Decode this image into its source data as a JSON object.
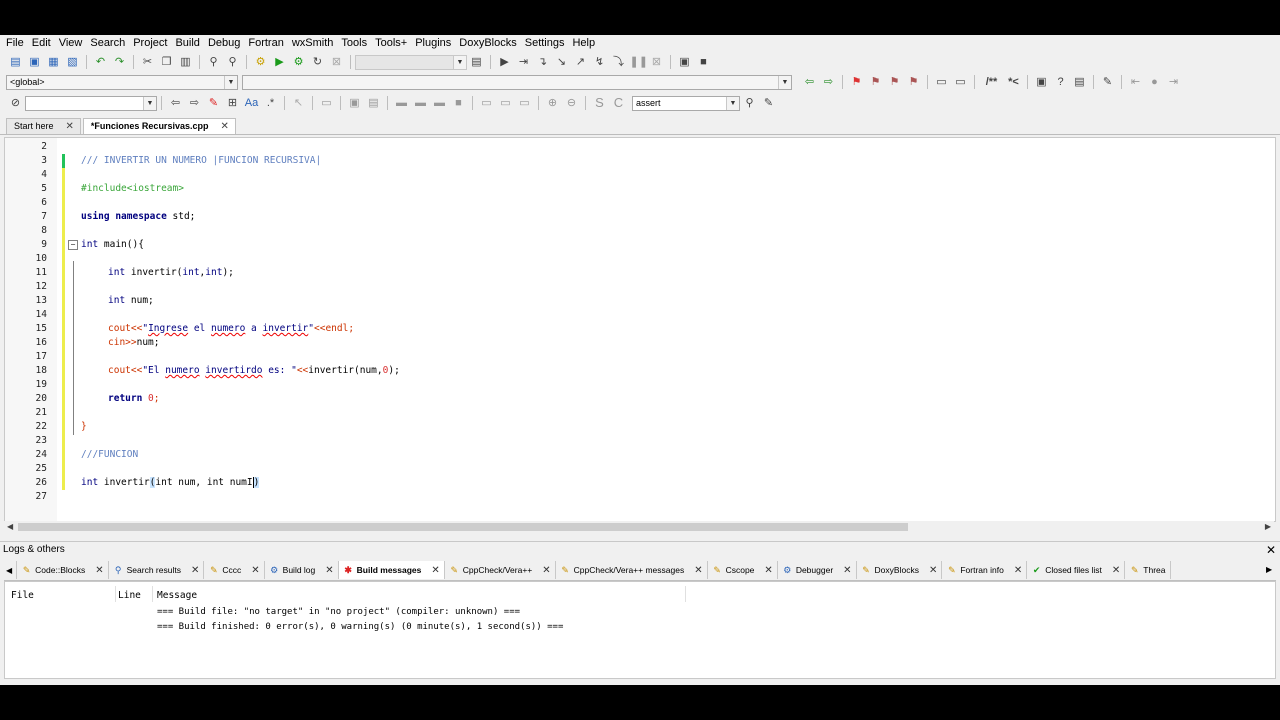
{
  "menu": [
    "File",
    "Edit",
    "View",
    "Search",
    "Project",
    "Build",
    "Debug",
    "Fortran",
    "wxSmith",
    "Tools",
    "Tools+",
    "Plugins",
    "DoxyBlocks",
    "Settings",
    "Help"
  ],
  "toolbar": {
    "scope_combo": "<global>",
    "search_combo_value": "assert"
  },
  "tabs": [
    {
      "label": "Start here",
      "active": false
    },
    {
      "label": "*Funciones Recursivas.cpp",
      "active": true
    }
  ],
  "editor": {
    "line_numbers": [
      "2",
      "3",
      "4",
      "5",
      "6",
      "7",
      "8",
      "9",
      "10",
      "11",
      "12",
      "13",
      "14",
      "15",
      "16",
      "17",
      "18",
      "19",
      "20",
      "21",
      "22",
      "23",
      "24",
      "25",
      "26",
      "27"
    ],
    "code": {
      "l3": "/// INVERTIR UN NUMERO |FUNCION RECURSIVA|",
      "l5": "#include<iostream>",
      "l7_kw": "using namespace",
      "l7_rest": " std;",
      "l9_int": "int",
      "l9_rest": " main(){",
      "l11_int": "int",
      "l11_rest": " invertir(",
      "l11_t1": "int",
      "l11_c": ",",
      "l11_t2": "int",
      "l11_end": ");",
      "l13_int": "int",
      "l13_rest": " num;",
      "l15_cout": "cout<<",
      "l15_q": "\"",
      "l15_w1": "Ingrese",
      "l15_mid": " el ",
      "l15_w2": "numero",
      "l15_mid2": " a ",
      "l15_w3": "invertir",
      "l15_q2": "\"",
      "l15_end": "<<endl;",
      "l16_cin": "cin>>",
      "l16_rest": "num;",
      "l18_cout": "cout<<",
      "l18_q": "\"El ",
      "l18_w1": "numero",
      "l18_sp": " ",
      "l18_w2": "invertirdo",
      "l18_rest": " es: \"",
      "l18_op": "<<",
      "l18_call": "invertir(num,",
      "l18_zero": "0",
      "l18_end": ");",
      "l20_ret": "return",
      "l20_zero": " 0",
      "l20_end": ";",
      "l22": "}",
      "l24": "///FUNCION",
      "l26_int": "int",
      "l26_name": " invertir",
      "l26_paren": "(",
      "l26_rest": "int num, int numI",
      "l26_close": ")"
    }
  },
  "logs": {
    "title": "Logs & others",
    "tabs": [
      {
        "label": "Code::Blocks",
        "icon": "pencil-icon"
      },
      {
        "label": "Search results",
        "icon": "search-icon"
      },
      {
        "label": "Cccc",
        "icon": "pencil-icon"
      },
      {
        "label": "Build log",
        "icon": "gear-icon"
      },
      {
        "label": "Build messages",
        "icon": "bookmark-icon",
        "active": true
      },
      {
        "label": "CppCheck/Vera++",
        "icon": "pencil-icon"
      },
      {
        "label": "CppCheck/Vera++ messages",
        "icon": "pencil-icon"
      },
      {
        "label": "Cscope",
        "icon": "pencil-icon"
      },
      {
        "label": "Debugger",
        "icon": "gear-icon"
      },
      {
        "label": "DoxyBlocks",
        "icon": "pencil-icon"
      },
      {
        "label": "Fortran info",
        "icon": "pencil-icon"
      },
      {
        "label": "Closed files list",
        "icon": "check-icon"
      },
      {
        "label": "Threa",
        "icon": "pencil-icon"
      }
    ],
    "columns": [
      "File",
      "Line",
      "Message"
    ],
    "messages": [
      "=== Build file: \"no target\" in \"no project\" (compiler: unknown) ===",
      "=== Build finished: 0 error(s), 0 warning(s) (0 minute(s), 1 second(s)) ==="
    ]
  },
  "colors": {
    "keyword": "#00007f",
    "comment": "#5f7fbf",
    "preprocessor": "#3aa63a",
    "number": "#d92e2e",
    "change_marker": "#eded4c",
    "saved_marker": "#21c25a"
  }
}
